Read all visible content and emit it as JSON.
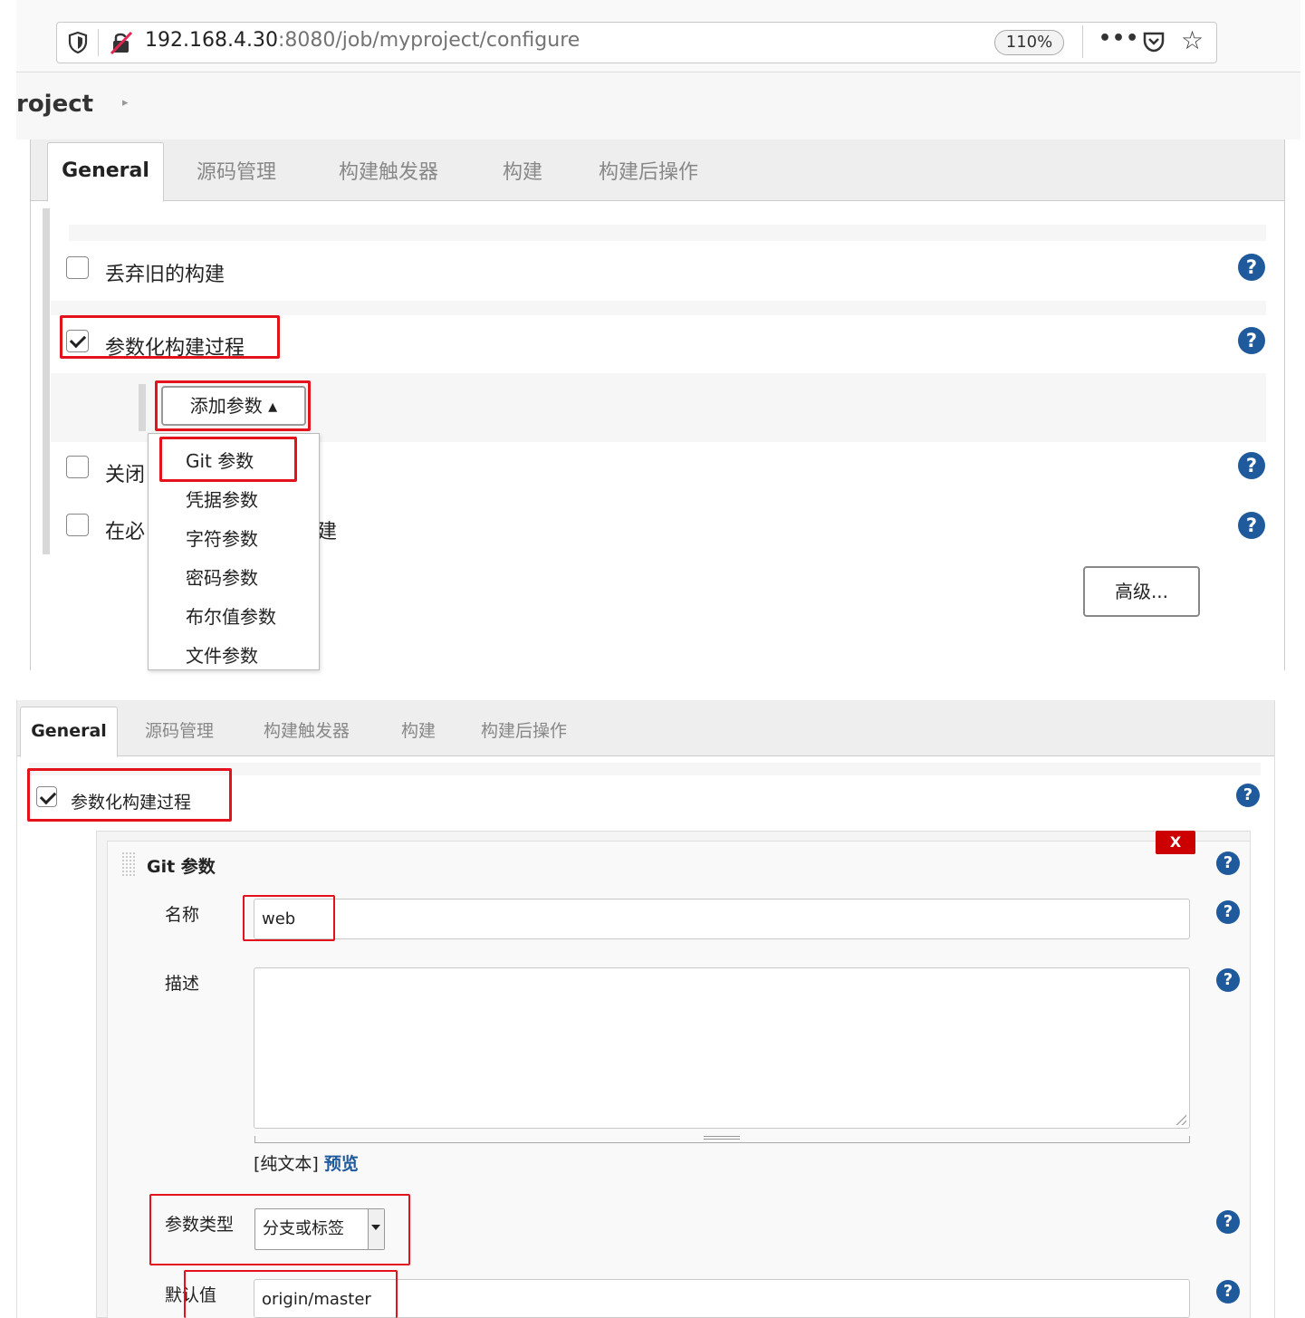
{
  "browser": {
    "url_host": "192.168.4.30",
    "url_path": ":8080/job/myproject/configure",
    "zoom": "110%",
    "more_label": "•••",
    "star_label": "☆",
    "icons": [
      "shield-icon",
      "insecure-connection-icon",
      "pocket-icon",
      "star-icon",
      "more-icon"
    ]
  },
  "breadcrumb": {
    "project": "roject"
  },
  "tabs": [
    "General",
    "源码管理",
    "构建触发器",
    "构建",
    "构建后操作"
  ],
  "panel1": {
    "options": [
      {
        "label": "丢弃旧的构建",
        "checked": false
      },
      {
        "label": "参数化构建过程",
        "checked": true
      },
      {
        "label": "关闭",
        "checked": false
      },
      {
        "label": "在必",
        "checked": false
      }
    ],
    "hidden_suffix": "建",
    "add_param_button": "添加参数 ▴",
    "param_menu": [
      "Git 参数",
      "凭据参数",
      "字符参数",
      "密码参数",
      "布尔值参数",
      "文件参数"
    ],
    "advanced_button": "高级...",
    "help_label": "?"
  },
  "panel2": {
    "parameterized_label": "参数化构建过程",
    "parameterized_checked": true,
    "block_title": "Git 参数",
    "delete_label": "X",
    "name_label": "名称",
    "name_value": "web",
    "desc_label": "描述",
    "desc_value": "",
    "format_plain": "[纯文本]",
    "format_preview": "预览",
    "param_type_label": "参数类型",
    "param_type_value": "分支或标签",
    "default_label": "默认值",
    "default_value": "origin/master",
    "help_label": "?"
  },
  "colors": {
    "highlight": "#e3121b",
    "help_icon": "#1f5a9c",
    "delete_button": "#cc0000"
  }
}
